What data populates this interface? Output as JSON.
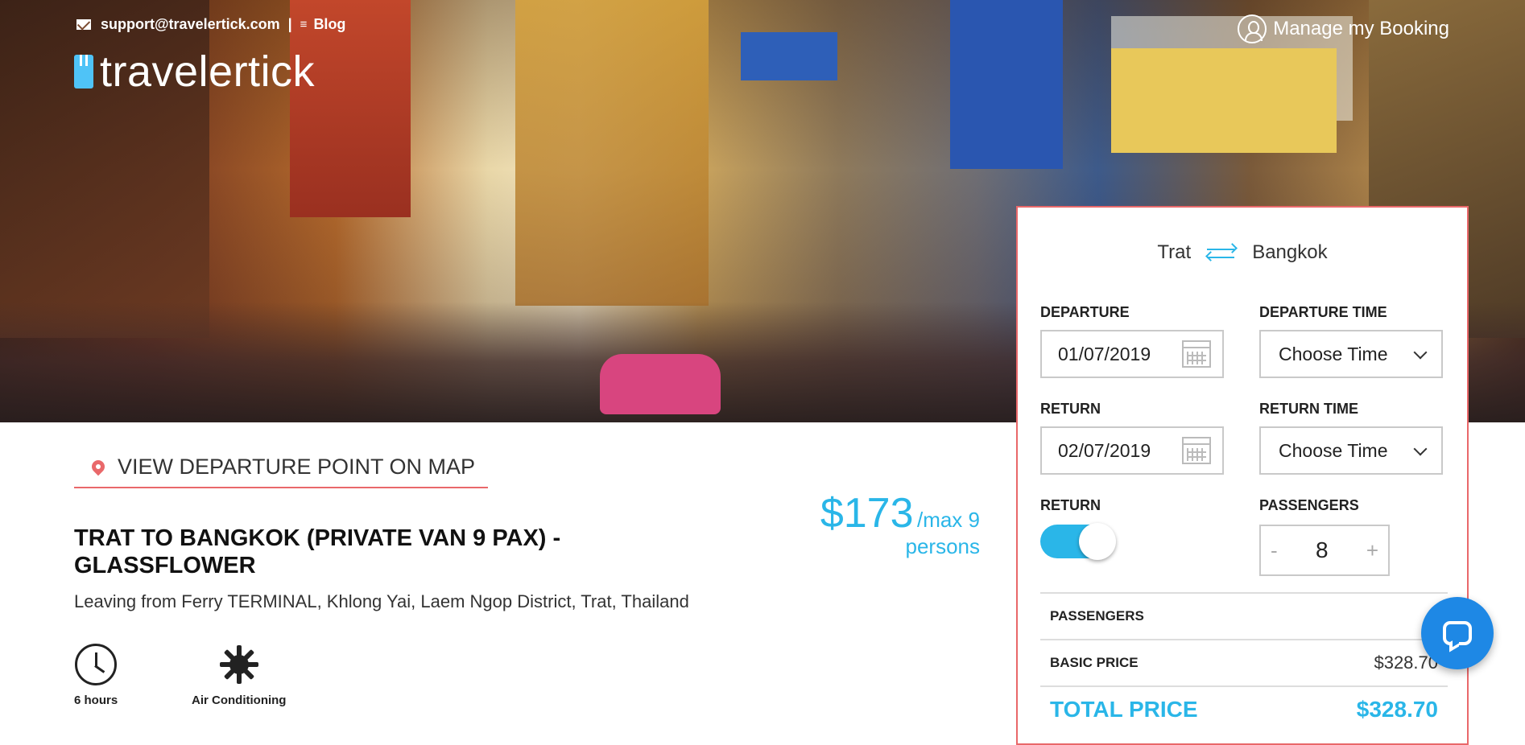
{
  "header": {
    "email": "support@travelertick.com",
    "separator": "|",
    "blog_label": "Blog",
    "logo_text": "travelertick",
    "manage_label": "Manage my Booking"
  },
  "map": {
    "label": "VIEW DEPARTURE POINT ON MAP"
  },
  "trip": {
    "title": "TRAT TO BANGKOK (PRIVATE VAN 9 PAX) - GLASSFLOWER",
    "leaving": "Leaving from Ferry TERMINAL, Khlong Yai, Laem Ngop District, Trat, Thailand",
    "price": "$173",
    "price_per": "/max 9",
    "price_persons": "persons",
    "features": [
      {
        "icon": "clock-icon",
        "label": "6 hours"
      },
      {
        "icon": "snowflake-icon",
        "label": "Air Conditioning"
      }
    ]
  },
  "booking": {
    "from": "Trat",
    "to": "Bangkok",
    "departure_label": "DEPARTURE",
    "departure_value": "01/07/2019",
    "departure_time_label": "DEPARTURE TIME",
    "departure_time_value": "Choose Time",
    "return_label": "RETURN",
    "return_value": "02/07/2019",
    "return_time_label": "RETURN TIME",
    "return_time_value": "Choose Time",
    "return_toggle_label": "RETURN",
    "return_toggle_on": true,
    "passengers_label": "PASSENGERS",
    "passengers_minus": "-",
    "passengers_value": "8",
    "passengers_plus": "+",
    "summary": [
      {
        "key": "PASSENGERS",
        "value": ""
      },
      {
        "key": "BASIC PRICE",
        "value": "$328.70"
      }
    ],
    "total_label": "TOTAL PRICE",
    "total_value": "$328.70"
  },
  "colors": {
    "accent": "#2ab6e8",
    "panel_border": "#e9686a",
    "chat": "#1e88e5"
  }
}
